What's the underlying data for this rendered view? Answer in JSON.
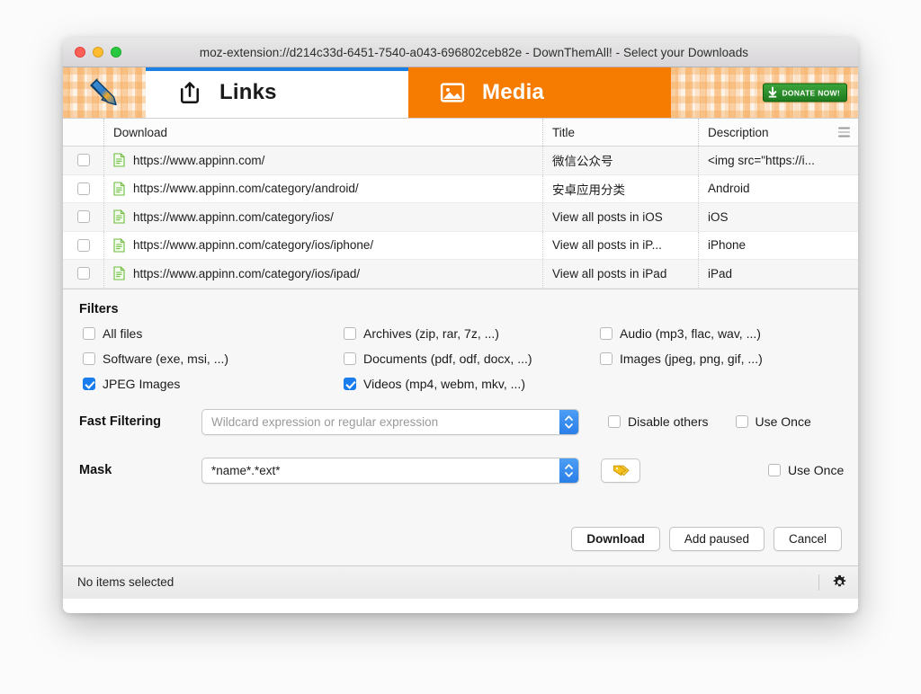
{
  "window": {
    "title": "moz-extension://d214c33d-6451-7540-a043-696802ceb82e - DownThemAll! - Select your Downloads",
    "traffic_lights": [
      "close",
      "minimize",
      "zoom"
    ]
  },
  "tabs": {
    "logo_alt": "downthemall-logo",
    "items": [
      {
        "label": "Links",
        "icon": "share-icon",
        "active": false
      },
      {
        "label": "Media",
        "icon": "image-icon",
        "active": true
      }
    ],
    "donate": {
      "label": "DONATE NOW!",
      "icon": "download-arrow-icon",
      "color": "#2a8a2a"
    }
  },
  "table": {
    "columns": [
      "Download",
      "Title",
      "Description"
    ],
    "column_menu_icon": "column-options-icon",
    "rows": [
      {
        "checked": false,
        "icon": "document-icon",
        "download": "https://www.appinn.com/",
        "title": "微信公众号",
        "description": "<img src=\"https://i..."
      },
      {
        "checked": false,
        "icon": "document-icon",
        "download": "https://www.appinn.com/category/android/",
        "title": "安卓应用分类",
        "description": "Android"
      },
      {
        "checked": false,
        "icon": "document-icon",
        "download": "https://www.appinn.com/category/ios/",
        "title": "View all posts in iOS",
        "description": "iOS"
      },
      {
        "checked": false,
        "icon": "document-icon",
        "download": "https://www.appinn.com/category/ios/iphone/",
        "title": "View all posts in iP...",
        "description": "iPhone"
      },
      {
        "checked": false,
        "icon": "document-icon",
        "download": "https://www.appinn.com/category/ios/ipad/",
        "title": "View all posts in iPad",
        "description": "iPad"
      }
    ]
  },
  "filters": {
    "heading": "Filters",
    "items": [
      {
        "label": "All files",
        "checked": false
      },
      {
        "label": "Archives (zip, rar, 7z, ...)",
        "checked": false
      },
      {
        "label": "Audio (mp3, flac, wav, ...)",
        "checked": false
      },
      {
        "label": "Software (exe, msi, ...)",
        "checked": false
      },
      {
        "label": "Documents (pdf, odf, docx, ...)",
        "checked": false
      },
      {
        "label": "Images (jpeg, png, gif, ...)",
        "checked": false
      },
      {
        "label": "JPEG Images",
        "checked": true
      },
      {
        "label": "Videos (mp4, webm, mkv, ...)",
        "checked": true
      }
    ]
  },
  "fast_filtering": {
    "label": "Fast Filtering",
    "value": "",
    "placeholder": "Wildcard expression or regular expression",
    "disable_others": {
      "label": "Disable others",
      "checked": false
    },
    "use_once": {
      "label": "Use Once",
      "checked": false
    }
  },
  "mask": {
    "label": "Mask",
    "value": "*name*.*ext*",
    "placeholder": "",
    "tag_icon": "tag-icon",
    "use_once": {
      "label": "Use Once",
      "checked": false
    }
  },
  "buttons": {
    "download": "Download",
    "add_paused": "Add paused",
    "cancel": "Cancel"
  },
  "status": {
    "text": "No items selected",
    "gear_icon": "gear-icon"
  },
  "colors": {
    "accent_orange": "#f57c00",
    "accent_blue": "#1b7fe3",
    "checkbox_blue": "#1a7ded",
    "donate_green": "#2a8a2a"
  }
}
